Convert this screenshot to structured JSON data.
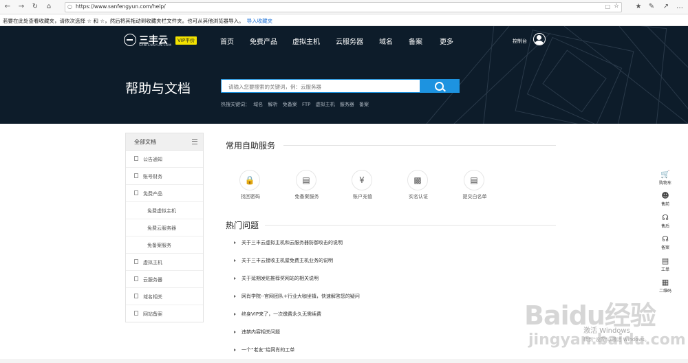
{
  "browser": {
    "url": "https://www.sanfengyun.com/help/",
    "favbar_message": "若要在此处查看收藏夹，请依次选择 ☆ 和 ☆，然后将其拖动到收藏夹栏文件夹。也可从其他浏览器导入。",
    "favbar_import": "导入收藏夹"
  },
  "header": {
    "logo_text": "三丰云",
    "logo_sub": "SANFENGYUN.COM",
    "vip_badge": "VIP平价",
    "menu": [
      "首页",
      "免费产品",
      "虚拟主机",
      "云服务器",
      "域名",
      "备案",
      "更多"
    ],
    "console": "控制台"
  },
  "hero": {
    "title": "帮助与文档",
    "search_placeholder": "请输入您要搜索的关键词，例：云服务器",
    "hot_label": "热搜关键词：",
    "hot_keywords": [
      "域名",
      "解析",
      "免备案",
      "FTP",
      "虚拟主机",
      "服务器",
      "备案"
    ]
  },
  "sidebar": {
    "title": "全部文档",
    "items": [
      {
        "label": "公告通知",
        "sub": false
      },
      {
        "label": "账号财务",
        "sub": false
      },
      {
        "label": "免费产品",
        "sub": false
      },
      {
        "label": "免费虚拟主机",
        "sub": true
      },
      {
        "label": "免费云服务器",
        "sub": true
      },
      {
        "label": "免备案服务",
        "sub": true
      },
      {
        "label": "虚拟主机",
        "sub": false
      },
      {
        "label": "云服务器",
        "sub": false
      },
      {
        "label": "域名相关",
        "sub": false
      },
      {
        "label": "网站备案",
        "sub": false
      }
    ]
  },
  "self_service": {
    "title": "常用自助服务",
    "items": [
      {
        "label": "找回密码",
        "icon": "lock-icon"
      },
      {
        "label": "免备案服务",
        "icon": "card-icon"
      },
      {
        "label": "账户充值",
        "icon": "yen-icon"
      },
      {
        "label": "实名认证",
        "icon": "id-icon"
      },
      {
        "label": "提交白名单",
        "icon": "doc-icon"
      }
    ]
  },
  "hot_questions": {
    "title": "热门问题",
    "items": [
      "关于三丰云虚拟主机和云服务器防御攻击的说明",
      "关于三丰云接收主机屋免费主机业务的说明",
      "关于延期发贴推荐奖网站的相关说明",
      "网肖学院--官网团队+行业大咖坐镇，快速解答您的疑问",
      "终身VIP来了，一次缴费永久无需续费",
      "违禁内容相关问题",
      "一个“老友”给网肖的工单"
    ]
  },
  "right_rail": [
    {
      "label": "购物车",
      "icon": "cart-icon"
    },
    {
      "label": "售前",
      "icon": "support-icon"
    },
    {
      "label": "售后",
      "icon": "headset-icon"
    },
    {
      "label": "备案",
      "icon": "filing-icon"
    },
    {
      "label": "工单",
      "icon": "ticket-icon"
    },
    {
      "label": "二维码",
      "icon": "qrcode-icon"
    }
  ],
  "watermark": {
    "activate_title": "激活 Windows",
    "activate_sub": "转到\"设置\"以激活 Windows。",
    "baidu": "Baidu经验",
    "jingyan": "jingyan.baidu.com"
  },
  "colors": {
    "hero_bg": "#0d1c2a",
    "accent": "#1d93e0",
    "vip": "#f3e200"
  }
}
